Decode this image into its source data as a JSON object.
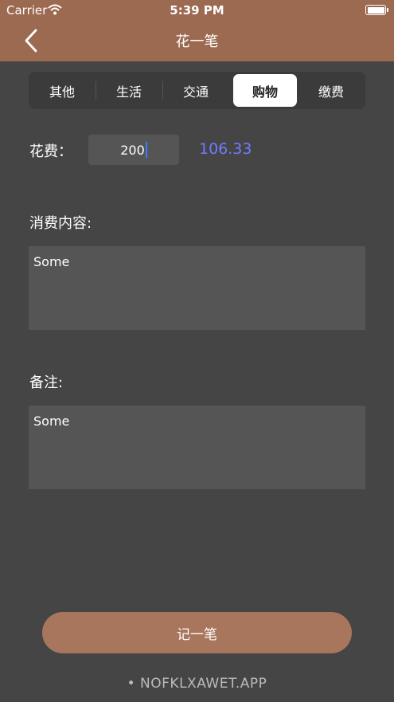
{
  "status": {
    "carrier": "Carrier",
    "time": "5:39 PM"
  },
  "nav": {
    "title": "花一笔"
  },
  "tabs": [
    {
      "label": "其他",
      "selected": false
    },
    {
      "label": "生活",
      "selected": false
    },
    {
      "label": "交通",
      "selected": false
    },
    {
      "label": "购物",
      "selected": true
    },
    {
      "label": "缴费",
      "selected": false
    }
  ],
  "amount": {
    "label": "花费：",
    "value": "200",
    "converted": "106.33"
  },
  "content": {
    "label": "消费内容:",
    "value": "Some"
  },
  "note": {
    "label": "备注:",
    "value": "Some"
  },
  "submit": {
    "label": "记一笔"
  },
  "watermark": "• NOFKLXAWET.APP",
  "colors": {
    "header": "#9c6a50",
    "background": "#454545",
    "button": "#a8765c",
    "rate": "#6f7cff"
  }
}
